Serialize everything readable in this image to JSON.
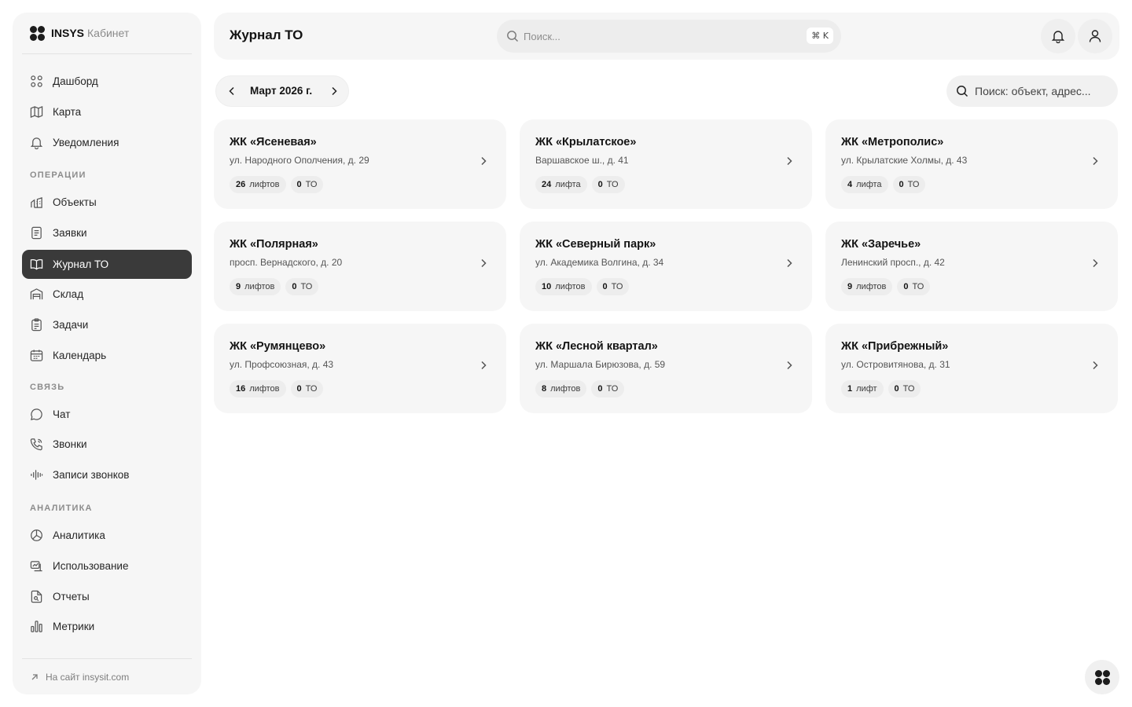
{
  "brand": {
    "name": "INSYS",
    "subtitle": "Кабинет"
  },
  "nav": {
    "items": [
      {
        "label": "Дашборд",
        "icon": "dashboard-icon"
      },
      {
        "label": "Карта",
        "icon": "map-icon"
      },
      {
        "label": "Уведомления",
        "icon": "bell-icon"
      },
      {
        "label": "Объекты",
        "icon": "objects-icon"
      },
      {
        "label": "Заявки",
        "icon": "requests-icon"
      },
      {
        "label": "Журнал ТО",
        "icon": "journal-icon",
        "active": true
      },
      {
        "label": "Склад",
        "icon": "warehouse-icon"
      },
      {
        "label": "Задачи",
        "icon": "tasks-icon"
      },
      {
        "label": "Календарь",
        "icon": "calendar-icon"
      },
      {
        "label": "Чат",
        "icon": "chat-icon"
      },
      {
        "label": "Звонки",
        "icon": "phone-icon"
      },
      {
        "label": "Записи звонков",
        "icon": "audio-wave-icon"
      },
      {
        "label": "Аналитика",
        "icon": "pie-chart-icon"
      },
      {
        "label": "Использование",
        "icon": "usage-icon"
      },
      {
        "label": "Отчеты",
        "icon": "reports-icon"
      },
      {
        "label": "Метрики",
        "icon": "bar-chart-icon"
      }
    ],
    "sections": [
      "ОПЕРАЦИИ",
      "СВЯЗЬ",
      "АНАЛИТИКА"
    ],
    "footer_link": "На сайт insysit.com"
  },
  "header": {
    "title": "Журнал ТО",
    "search_placeholder": "Поиск...",
    "shortcut": "⌘ K"
  },
  "toolbar": {
    "month": "Март 2026 г.",
    "object_search_placeholder": "Поиск: объект, адрес..."
  },
  "objects": [
    {
      "name": "ЖК «Ясеневая»",
      "address": "ул. Народного Ополчения, д. 29",
      "lifts_count": "26",
      "lifts_word": "лифтов",
      "to_count": "0",
      "to_word": "ТО"
    },
    {
      "name": "ЖК «Крылатское»",
      "address": "Варшавское ш., д. 41",
      "lifts_count": "24",
      "lifts_word": "лифта",
      "to_count": "0",
      "to_word": "ТО"
    },
    {
      "name": "ЖК «Метрополис»",
      "address": "ул. Крылатские Холмы, д. 43",
      "lifts_count": "4",
      "lifts_word": "лифта",
      "to_count": "0",
      "to_word": "ТО"
    },
    {
      "name": "ЖК «Полярная»",
      "address": "просп. Вернадского, д. 20",
      "lifts_count": "9",
      "lifts_word": "лифтов",
      "to_count": "0",
      "to_word": "ТО"
    },
    {
      "name": "ЖК «Северный парк»",
      "address": "ул. Академика Волгина, д. 34",
      "lifts_count": "10",
      "lifts_word": "лифтов",
      "to_count": "0",
      "to_word": "ТО"
    },
    {
      "name": "ЖК «Заречье»",
      "address": "Ленинский просп., д. 42",
      "lifts_count": "9",
      "lifts_word": "лифтов",
      "to_count": "0",
      "to_word": "ТО"
    },
    {
      "name": "ЖК «Румянцево»",
      "address": "ул. Профсоюзная, д. 43",
      "lifts_count": "16",
      "lifts_word": "лифтов",
      "to_count": "0",
      "to_word": "ТО"
    },
    {
      "name": "ЖК «Лесной квартал»",
      "address": "ул. Маршала Бирюзова, д. 59",
      "lifts_count": "8",
      "lifts_word": "лифтов",
      "to_count": "0",
      "to_word": "ТО"
    },
    {
      "name": "ЖК «Прибрежный»",
      "address": "ул. Островитянова, д. 31",
      "lifts_count": "1",
      "lifts_word": "лифт",
      "to_count": "0",
      "to_word": "ТО"
    }
  ],
  "colors": {
    "active_nav_bg": "#3a3a3a",
    "card_bg": "#f6f6f6",
    "text": "#1c1c1c"
  }
}
